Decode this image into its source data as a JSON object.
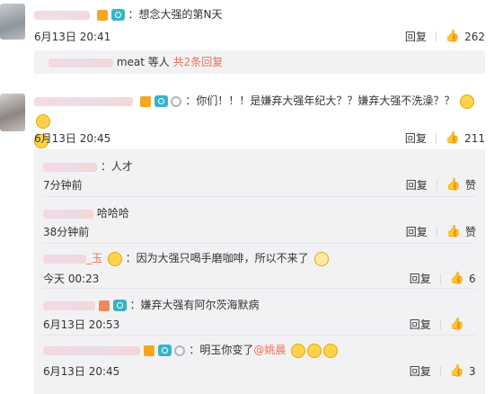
{
  "actions": {
    "reply_label": "回复",
    "like_icon": "thumbs-up-icon",
    "like_label": "赞"
  },
  "comments": [
    {
      "text": "：想念大强的第N天",
      "time": "6月13日 20:41",
      "likes": "262"
    },
    {
      "text": "：你们！！！是嫌弃大强年纪大？？嫌弃大强不洗澡？？",
      "time": "6月13日 20:45",
      "likes": "211"
    }
  ],
  "summary": {
    "suffix_text": "meat 等人",
    "more_link": "共2条回复"
  },
  "subreplies": [
    {
      "text": "：人才",
      "time": "7分钟前",
      "likes": "赞"
    },
    {
      "text": "哈哈哈",
      "time": "38分钟前",
      "likes": "赞"
    },
    {
      "name_suffix": "_玉",
      "text": "：因为大强只喝手磨咖啡，所以不来了",
      "time": "今天 00:23",
      "likes": "6"
    },
    {
      "text": "：嫌弃大强有阿尔茨海默病",
      "time": "6月13日 20:53",
      "likes": ""
    },
    {
      "text": "：明玉你变了",
      "mention": "@姚晨",
      "time": "6月13日 20:45",
      "likes": "3"
    }
  ]
}
